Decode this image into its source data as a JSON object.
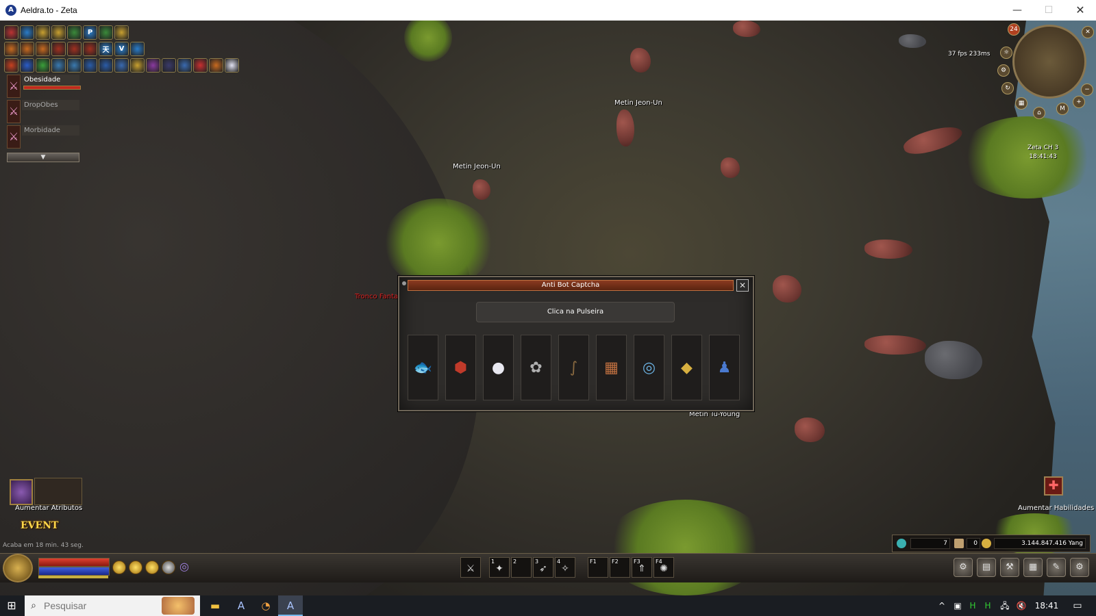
{
  "window": {
    "title": "Aeldra.to - Zeta",
    "minimize": "—",
    "maximize": "☐",
    "close": "✕"
  },
  "hud": {
    "fps": "37 fps 233ms",
    "server": "Zeta CH 3",
    "time": "18:41:43",
    "minimap_level": "24"
  },
  "skill_rows": [
    [
      "#b33",
      "#2a7cc8",
      "#c8a030",
      "#c8a030",
      "#3a8a3a",
      "#2a7cc8",
      "#3a8a3a",
      "#c8a030"
    ],
    [
      "#c86a20",
      "#c86a20",
      "#c86a20",
      "#a03020",
      "#a03020",
      "#a03020",
      "#2a7cc8",
      "#2a7cc8",
      "#2a7cc8"
    ],
    [
      "#c84020",
      "#2a5cc8",
      "#3aa03a",
      "#3a7ab0",
      "#3a7ab0",
      "#2a5ca8",
      "#2a5ca8",
      "#3a6ab0",
      "#c8a030",
      "#8a3aa0",
      "#3a3a6a",
      "#3a6ab0",
      "#c83030",
      "#c86a20",
      "#e0e0f0"
    ]
  ],
  "skill_row_labels": [
    [
      "",
      "",
      "",
      "",
      "",
      "P",
      "",
      ""
    ],
    [
      "",
      "",
      "",
      "",
      "",
      "",
      "天",
      "V",
      ""
    ],
    [
      "",
      "",
      "",
      "",
      "",
      "",
      "",
      "",
      "",
      "",
      "",
      "",
      "",
      "",
      ""
    ]
  ],
  "party": [
    {
      "name": "Obesidade"
    },
    {
      "name": "DropObes"
    },
    {
      "name": "Morbidade"
    }
  ],
  "world": {
    "names": [
      "Metin Jeon-Un",
      "Metin Jeon-Un",
      "Metin Tu-Young"
    ],
    "red_text": "Tronco Fanta"
  },
  "captcha": {
    "title": "Anti Bot Captcha",
    "instruction": "Clica na Pulseira",
    "close": "✕",
    "items": [
      {
        "glyph": "🐟",
        "color": "#e0704a"
      },
      {
        "glyph": "⬢",
        "color": "#c03a2a"
      },
      {
        "glyph": "●",
        "color": "#e8e8f0"
      },
      {
        "glyph": "✿",
        "color": "#b0b0b0"
      },
      {
        "glyph": "∫",
        "color": "#8a6a40"
      },
      {
        "glyph": "▦",
        "color": "#c07040"
      },
      {
        "glyph": "◎",
        "color": "#6ab0e0"
      },
      {
        "glyph": "◆",
        "color": "#d8b040"
      },
      {
        "glyph": "♟",
        "color": "#4a7ad0"
      }
    ]
  },
  "attributes": {
    "label": "Aumentar Atributos",
    "event": "EVENT",
    "timer": "Acaba em 18 min. 43 seg."
  },
  "skill_up": {
    "label": "Aumentar Habilidades",
    "icon": "✚"
  },
  "currency": {
    "gems": "7",
    "cheques": "0",
    "yang": "3.144.847.416 Yang"
  },
  "quickslots": [
    {
      "key": "",
      "glyph": "⚔"
    },
    {
      "key": "1",
      "glyph": "✦"
    },
    {
      "key": "2",
      "glyph": ""
    },
    {
      "key": "3",
      "glyph": "➶"
    },
    {
      "key": "4",
      "glyph": "✧"
    },
    {
      "key": "F1",
      "glyph": ""
    },
    {
      "key": "F2",
      "glyph": ""
    },
    {
      "key": "F3",
      "glyph": "⇑"
    },
    {
      "key": "F4",
      "glyph": "✺"
    }
  ],
  "menu_buttons": [
    "⚙",
    "▤",
    "⚒",
    "▦",
    "✎",
    "⚙"
  ],
  "taskbar": {
    "search_placeholder": "Pesquisar",
    "clock": "18:41",
    "tray_icons": [
      "^",
      "▣",
      "H",
      "H",
      "🖧",
      "🔇"
    ]
  }
}
